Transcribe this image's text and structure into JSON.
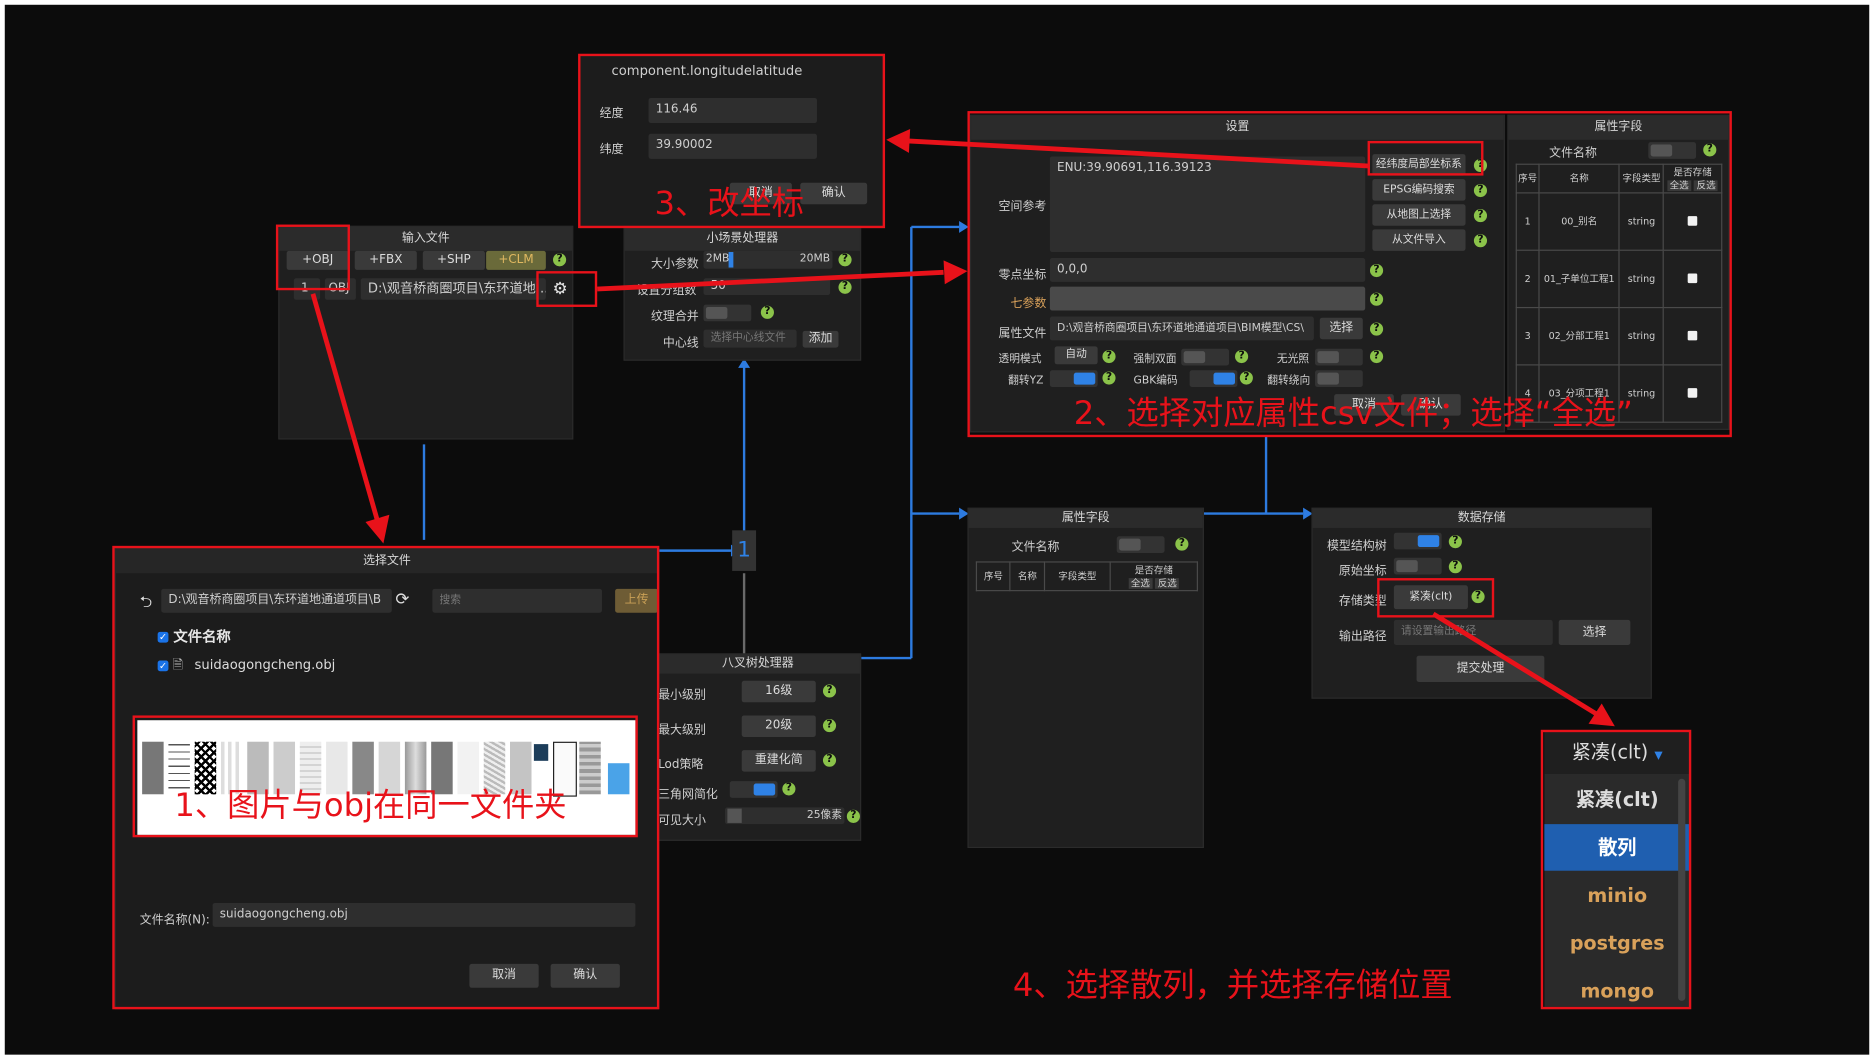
{
  "coord_dialog": {
    "title": "component.longitudelatitude",
    "lng_label": "经度",
    "lng_value": "116.46",
    "lat_label": "纬度",
    "lat_value": "39.90002",
    "cancel": "取消",
    "confirm": "确认"
  },
  "settings": {
    "title": "设置",
    "spatial_ref_label": "空间参考",
    "spatial_ref_value": "ENU:39.90691,116.39123",
    "btn_latlng": "经纬度局部坐标系",
    "btn_epsg": "EPSG编码搜索",
    "btn_map": "从地图上选择",
    "btn_file": "从文件导入",
    "zero_label": "零点坐标",
    "zero_value": "0,0,0",
    "seven_label": "七参数",
    "attr_file_label": "属性文件",
    "attr_file_value": "D:\\观音桥商圈项目\\东环道地通道项目\\BIM模型\\CS\\",
    "select_btn": "选择",
    "transparent_label": "透明模式",
    "transparent_value": "自动",
    "double_label": "强制双面",
    "nolight_label": "无光照",
    "flipyz_label": "翻转YZ",
    "gbk_label": "GBK编码",
    "flipwind_label": "翻转绕向",
    "cancel": "取消",
    "ok": "确认"
  },
  "attr_fields_top": {
    "title": "属性字段",
    "file_name_label": "文件名称",
    "headers": {
      "no": "序号",
      "name": "名称",
      "type": "字段类型",
      "store": "是否存储",
      "all": "全选",
      "invert": "反选"
    },
    "rows": [
      {
        "no": "1",
        "name": "00_别名",
        "type": "string"
      },
      {
        "no": "2",
        "name": "01_子单位工程1",
        "type": "string"
      },
      {
        "no": "3",
        "name": "02_分部工程1",
        "type": "string"
      },
      {
        "no": "4",
        "name": "03_分项工程1",
        "type": "string"
      }
    ]
  },
  "input_files": {
    "title": "输入文件",
    "btn_obj": "+OBJ",
    "btn_fbx": "+FBX",
    "btn_shp": "+SHP",
    "btn_clm": "+CLM",
    "row_no": "1",
    "row_type": "OBJ",
    "row_path": "D:\\观音桥商圈项目\\东环道地..."
  },
  "small_scene": {
    "title": "小场景处理器",
    "size_label": "大小参数",
    "size_min": "2MB",
    "size_max": "20MB",
    "param2_label": "设置分组数",
    "param2_value": "50",
    "merge_label": "纹理合并",
    "center_label": "中心线",
    "center_placeholder": "选择中心线文件",
    "add_btn": "添加"
  },
  "file_dialog": {
    "title": "选择文件",
    "path": "D:\\观音桥商圈项目\\东环道地通道项目\\B",
    "search_placeholder": "搜索",
    "upload": "上传",
    "col_header": "文件名称",
    "file": "suidaogongcheng.obj",
    "filename_label": "文件名称(N):",
    "filename_value": "suidaogongcheng.obj",
    "cancel": "取消",
    "confirm": "确认"
  },
  "octree": {
    "title": "八叉树处理器",
    "min_level_label": "最小级别",
    "min_level": "16级",
    "max_level_label": "最大级别",
    "max_level": "20级",
    "lod_label": "Lod策略",
    "lod_value": "重建化简",
    "simplify_label": "三角网简化",
    "visible_label": "可见大小",
    "visible_value": "25像素"
  },
  "attr_fields_mid": {
    "title": "属性字段",
    "file_name_label": "文件名称",
    "no": "序号",
    "name": "名称",
    "type": "字段类型",
    "store": "是否存储",
    "all": "全选",
    "invert": "反选"
  },
  "storage": {
    "title": "数据存储",
    "tree_label": "模型结构树",
    "orig_label": "原始坐标",
    "type_label": "存储类型",
    "type_value": "紧凑(clt)",
    "path_label": "输出路径",
    "path_placeholder": "请设置输出路径",
    "select_btn": "选择",
    "submit": "提交处理"
  },
  "dropdown": {
    "selected": "紧凑(clt)",
    "options": [
      "紧凑(clt)",
      "散列",
      "minio",
      "postgres",
      "mongo"
    ]
  },
  "counter": "1",
  "annotations": {
    "step1": "1、图片与obj在同一文件夹",
    "step2": "2、选择对应属性csv文件；选择“全选”",
    "step3": "3、改坐标",
    "step4": "4、选择散列，并选择存储位置"
  },
  "colors": {
    "background": "#0c0c0c",
    "panel": "#1f1f1f",
    "accent_blue": "#2f82e6",
    "annotation_red": "#e8121a",
    "help_green": "#8bc34a",
    "option_gold": "#d9a15a"
  }
}
